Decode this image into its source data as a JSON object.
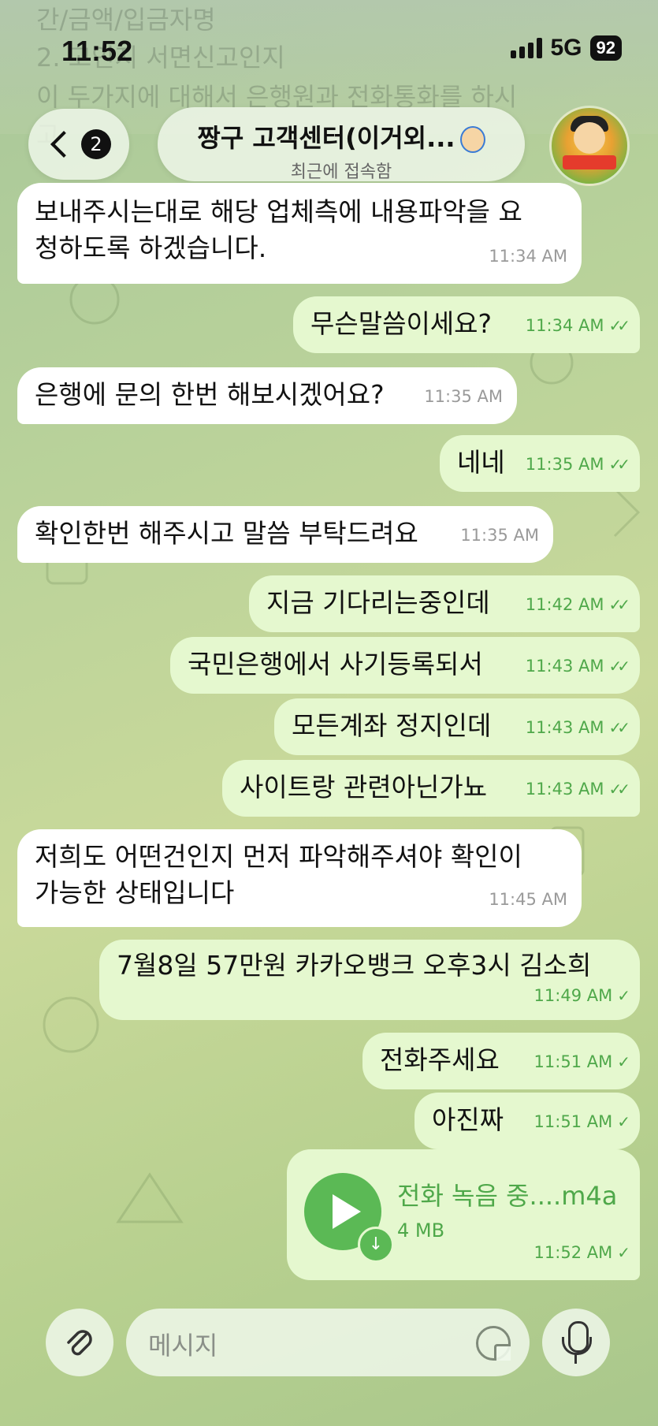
{
  "status_bar": {
    "time": "11:52",
    "network": "5G",
    "battery": "92"
  },
  "background_text": [
    "간/금액/입금자명",
    "2.          고인지 서면신고인지",
    "이 두가지에 대해서 은행원과 전화통화를 하시",
    "고"
  ],
  "header": {
    "back_count": "2",
    "title": "짱구 고객센터(이거외...",
    "subtitle": "최근에 접속함"
  },
  "messages": [
    {
      "dir": "in",
      "lines": [
        "보내주시는대로 해당 업체측에 내용파악을 요",
        "청하도록 하겠습니다."
      ],
      "time": "11:34 AM"
    },
    {
      "dir": "out",
      "text": "무슨말씀이세요?",
      "time": "11:34 AM",
      "read": true
    },
    {
      "dir": "in",
      "text": "은행에 문의 한번 해보시겠어요?",
      "time": "11:35 AM"
    },
    {
      "dir": "out",
      "text": "네네",
      "time": "11:35 AM",
      "read": true
    },
    {
      "dir": "in",
      "text": "확인한번 해주시고 말씀 부탁드려요",
      "time": "11:35 AM"
    },
    {
      "dir": "out",
      "text": "지금 기다리는중인데",
      "time": "11:42 AM",
      "read": true
    },
    {
      "dir": "out",
      "text": "국민은행에서 사기등록되서",
      "time": "11:43 AM",
      "read": true
    },
    {
      "dir": "out",
      "text": "모든계좌 정지인데",
      "time": "11:43 AM",
      "read": true
    },
    {
      "dir": "out",
      "text": "사이트랑 관련아닌가뇨",
      "time": "11:43 AM",
      "read": true
    },
    {
      "dir": "in",
      "lines": [
        "저희도 어떤건인지 먼저 파악해주셔야 확인이",
        "가능한 상태입니다"
      ],
      "time": "11:45 AM"
    },
    {
      "dir": "out",
      "text": "7월8일 57만원 카카오뱅크 오후3시 김소희",
      "time": "11:49 AM",
      "read": false
    },
    {
      "dir": "out",
      "text": "전화주세요",
      "time": "11:51 AM",
      "read": false
    },
    {
      "dir": "out",
      "text": "아진짜",
      "time": "11:51 AM",
      "read": false
    }
  ],
  "audio": {
    "filename": "전화 녹음 중....m4a",
    "size": "4 MB",
    "time": "11:52 AM"
  },
  "composer": {
    "placeholder": "메시지"
  },
  "colors": {
    "out_bubble": "#e5f8cf",
    "in_bubble": "#ffffff",
    "accent": "#4fa84a"
  }
}
